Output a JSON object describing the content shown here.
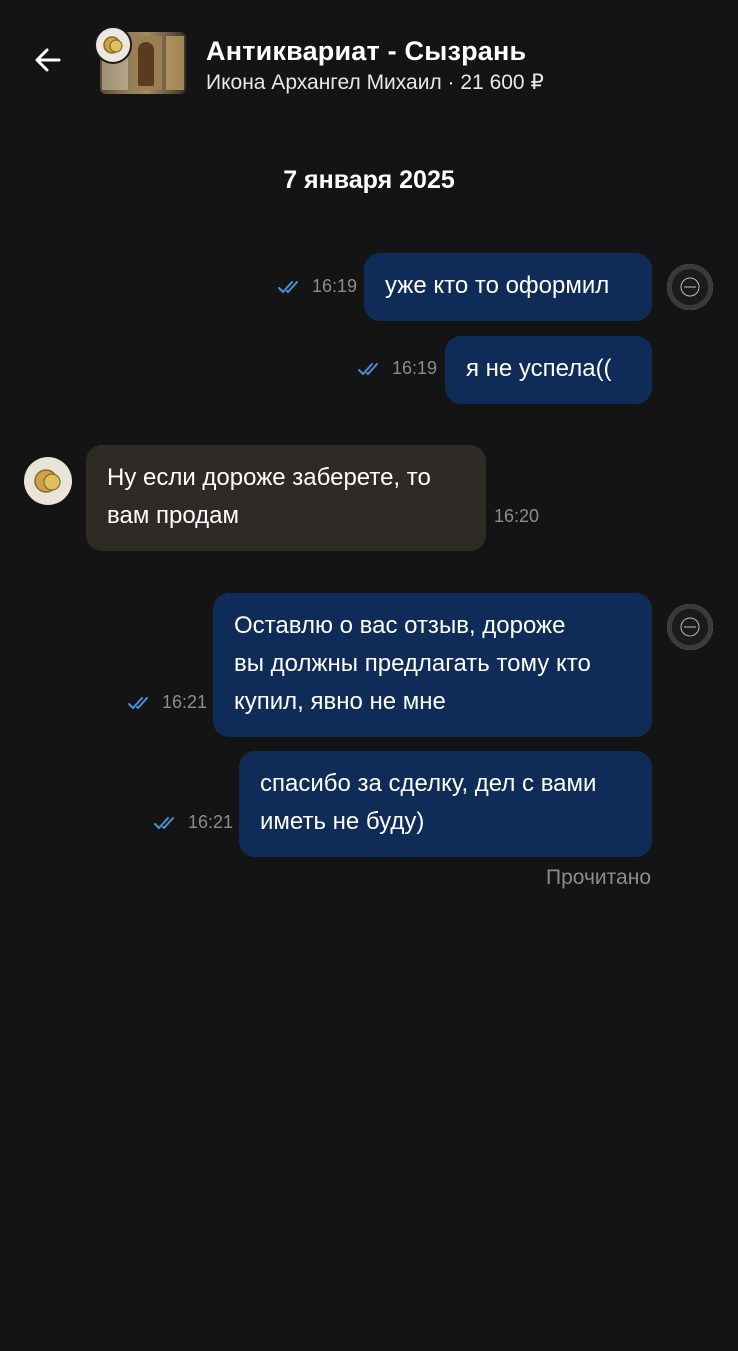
{
  "header": {
    "back_label": "",
    "shop_name": "Антиквариат - Сызрань",
    "listing": "Икона Архангел Михаил · 21 600 ₽"
  },
  "chat": {
    "date_separator": "7 января 2025",
    "messages": [
      {
        "direction": "out",
        "text_lines": [
          "уже кто то оформил"
        ],
        "time": "16:19",
        "status_icon": "double-check-icon"
      },
      {
        "direction": "out",
        "text_lines": [
          "я не успела(("
        ],
        "time": "16:19",
        "status_icon": "double-check-icon"
      },
      {
        "direction": "in",
        "text_lines": [
          "Ну если дороже заберете, то",
          "вам продам"
        ],
        "time": "16:20"
      },
      {
        "direction": "out",
        "text_lines": [
          "Оставлю о вас отзыв, дороже",
          "вы должны предлагать тому кто",
          "купил, явно не мне"
        ],
        "time": "16:21",
        "status_icon": "double-check-icon"
      },
      {
        "direction": "out",
        "text_lines": [
          "спасибо за сделку, дел с вами",
          "иметь не буду)"
        ],
        "time": "16:21",
        "status_icon": "double-check-icon"
      }
    ],
    "read_status": "Прочитано"
  },
  "colors": {
    "background": "#141414",
    "outgoing_bubble": "#0f2b57",
    "incoming_bubble": "#2e2a26",
    "check_marks": "#4a90d9",
    "muted_text": "#8c8c8c"
  }
}
